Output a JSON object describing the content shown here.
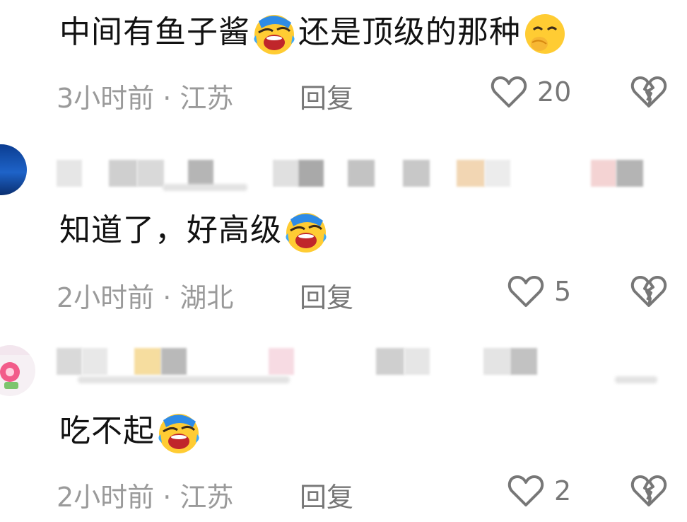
{
  "comments": [
    {
      "text_a": "中间有鱼子酱",
      "emoji_a": "laugh-cry-emoji",
      "text_b": "还是顶级的那种",
      "emoji_b": "hand-over-mouth-emoji",
      "time_location": "3小时前 · 江苏",
      "reply_label": "回复",
      "likes": "20"
    },
    {
      "text_a": "知道了，好高级",
      "emoji_a": "laugh-cry-emoji",
      "time_location": "2小时前 · 湖北",
      "reply_label": "回复",
      "likes": "5"
    },
    {
      "text_a": "吃不起",
      "emoji_a": "laugh-cry-emoji",
      "time_location": "2小时前 · 江苏",
      "reply_label": "回复",
      "likes": "2"
    }
  ],
  "icons": {
    "like": "heart-outline-icon",
    "dislike": "broken-heart-icon"
  },
  "colors": {
    "text": "#121212",
    "meta": "#9a9a9a",
    "icon": "#777777"
  }
}
